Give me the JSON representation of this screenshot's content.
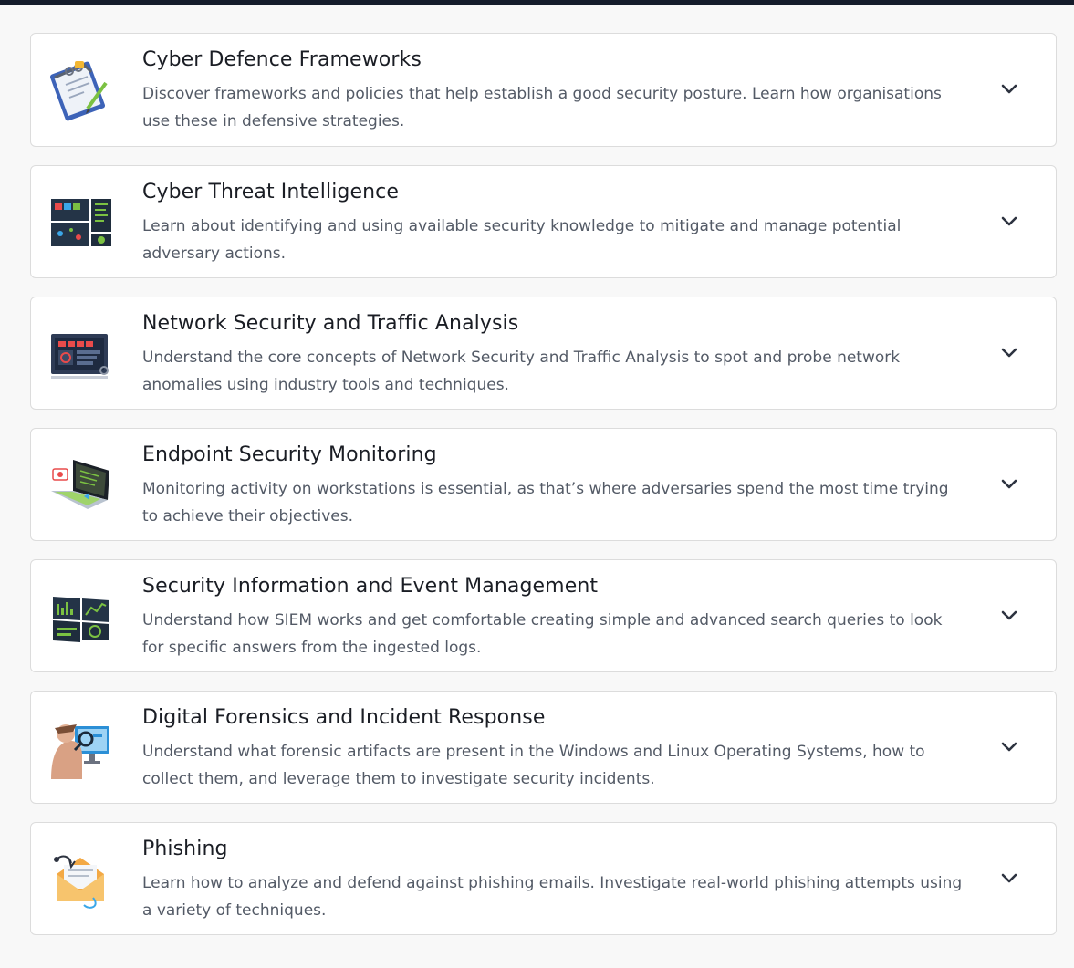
{
  "modules": [
    {
      "title": "Cyber Defence Frameworks",
      "description": "Discover frameworks and policies that help establish a good security posture. Learn how organisations use these in defensive strategies.",
      "icon": "clipboard-chain-icon"
    },
    {
      "title": "Cyber Threat Intelligence",
      "description": "Learn about identifying and using available security knowledge to mitigate and manage potential adversary actions.",
      "icon": "threat-dashboard-icon"
    },
    {
      "title": "Network Security and Traffic Analysis",
      "description": "Understand the core concepts of Network Security and Traffic Analysis to spot and probe network anomalies using industry tools and techniques.",
      "icon": "network-monitor-icon"
    },
    {
      "title": "Endpoint Security Monitoring",
      "description": "Monitoring activity on workstations is essential, as that’s where adversaries spend the most time trying to achieve their objectives.",
      "icon": "laptop-icon"
    },
    {
      "title": "Security Information and Event Management",
      "description": "Understand how SIEM works and get comfortable creating simple and advanced search queries to look for specific answers from the ingested logs.",
      "icon": "siem-screens-icon"
    },
    {
      "title": "Digital Forensics and Incident Response",
      "description": "Understand what forensic artifacts are present in the Windows and Linux Operating Systems, how to collect them, and leverage them to investigate security incidents.",
      "icon": "forensics-investigator-icon"
    },
    {
      "title": "Phishing",
      "description": "Learn how to analyze and defend against phishing emails. Investigate real-world phishing attempts using a variety of techniques.",
      "icon": "phishing-envelope-icon"
    }
  ],
  "chevron_icon": "chevron-down-icon",
  "colors": {
    "topbar": "#151c2b",
    "background": "#f8f8f8",
    "card": "#ffffff",
    "title": "#1a1d24",
    "description": "#535a66"
  }
}
